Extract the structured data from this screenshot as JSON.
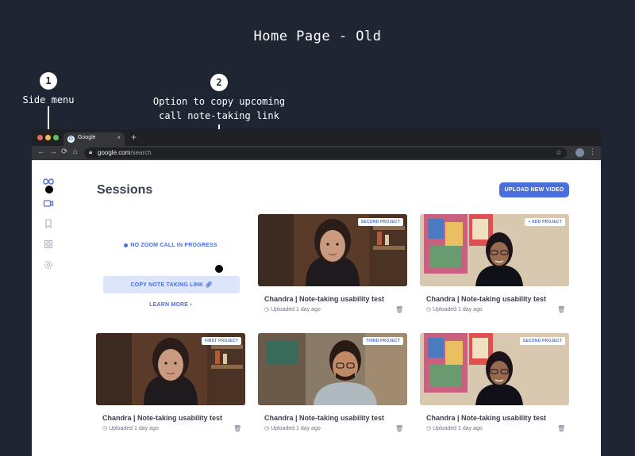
{
  "page": {
    "heading": "Home Page - Old"
  },
  "annotations": [
    {
      "number": "1",
      "label": "Side menu"
    },
    {
      "number": "2",
      "label_line1": "Option to copy upcoming",
      "label_line2": "call note-taking link"
    }
  ],
  "browser": {
    "tab_title": "Google",
    "tab_close": "×",
    "new_tab": "+",
    "url_host": "google.com",
    "url_path": "/search"
  },
  "app": {
    "title": "Sessions",
    "upload_button": "UPLOAD NEW VIDEO",
    "promo": {
      "status": "NO ZOOM CALL IN PROGRESS",
      "copy_button": "COPY NOTE TAKING LINK",
      "learn_more": "LEARN MORE"
    },
    "cards": [
      {
        "tag": "SECOND PROJECT",
        "title": "Chandra | Note-taking usability test",
        "meta": "Uploaded 1 day ago",
        "scene": "woman-shelf"
      },
      {
        "tag": "+ ADD PROJECT",
        "title": "Chandra | Note-taking usability test",
        "meta": "Uploaded 1 day ago",
        "scene": "woman-art"
      },
      {
        "tag": "FIRST PROJECT",
        "title": "Chandra | Note-taking usability test",
        "meta": "Uploaded 1 day ago",
        "scene": "woman-shelf"
      },
      {
        "tag": "THIRD PROJECT",
        "title": "Chandra | Note-taking usability test",
        "meta": "Uploaded 1 day ago",
        "scene": "man-glasses"
      },
      {
        "tag": "SECOND PROJECT",
        "title": "Chandra | Note-taking usability test",
        "meta": "Uploaded 1 day ago",
        "scene": "woman-art"
      }
    ]
  },
  "icons": {
    "logo": "infinity-logo-icon",
    "video": "video-icon",
    "bookmark": "bookmark-icon",
    "grid": "grid-icon",
    "settings": "settings-icon",
    "trash": "trash-icon",
    "clock": "clock-icon",
    "link": "link-icon",
    "chevron": "chevron-right-icon"
  },
  "colors": {
    "accent": "#4a6fdc",
    "background": "#1f2533",
    "title": "#3b4050"
  }
}
